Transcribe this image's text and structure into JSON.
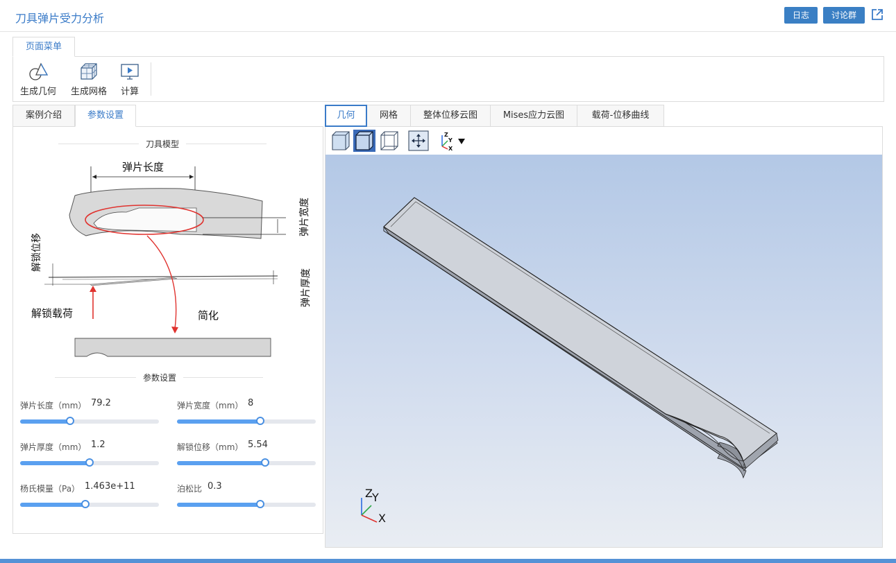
{
  "header": {
    "title": "刀具弹片受力分析",
    "log_button": "日志",
    "discuss_button": "讨论群"
  },
  "ribbon": {
    "tab_label": "页面菜单",
    "items": [
      {
        "label": "生成几何",
        "icon": "geometry-shapes-icon"
      },
      {
        "label": "生成网格",
        "icon": "mesh-cube-icon"
      },
      {
        "label": "计算",
        "icon": "compute-monitor-icon"
      }
    ]
  },
  "left_panel": {
    "tabs": [
      "案例介绍",
      "参数设置"
    ],
    "active_tab": "参数设置",
    "model_section_title": "刀具模型",
    "param_section_title": "参数设置",
    "diagram_labels": {
      "length": "弹片长度",
      "width": "弹片宽度",
      "unlock_disp": "解锁位移",
      "thickness": "弹片厚度",
      "unlock_load": "解锁载荷",
      "simplify": "简化"
    },
    "params": [
      {
        "label": "弹片长度（mm）",
        "value": "79.2",
        "fill": 0.36
      },
      {
        "label": "弹片宽度（mm）",
        "value": "8",
        "fill": 0.6
      },
      {
        "label": "弹片厚度（mm）",
        "value": "1.2",
        "fill": 0.5
      },
      {
        "label": "解锁位移（mm）",
        "value": "5.54",
        "fill": 0.635
      },
      {
        "label": "杨氏模量（Pa）",
        "value": "1.463e+11",
        "fill": 0.47
      },
      {
        "label": "泊松比",
        "value": "0.3",
        "fill": 0.6
      }
    ]
  },
  "viewer": {
    "tabs": [
      "几何",
      "网格",
      "整体位移云图",
      "Mises应力云图",
      "载荷-位移曲线"
    ],
    "active_tab": "几何",
    "axis_labels": {
      "x": "X",
      "y": "Y",
      "z": "Z"
    }
  },
  "colors": {
    "accent": "#3a7bc8",
    "button": "#3a7fc4",
    "slider_fill": "#5aa0f0",
    "annotation_red": "#e0332f"
  }
}
